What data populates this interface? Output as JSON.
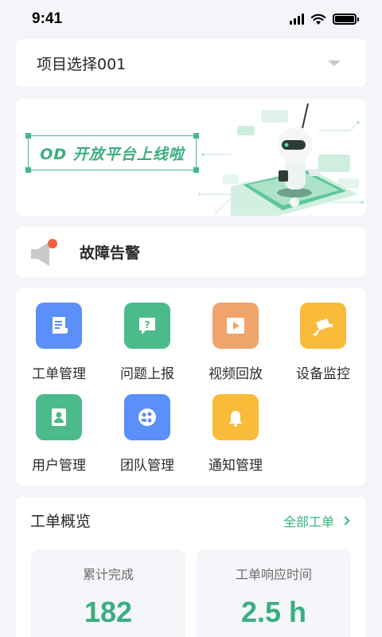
{
  "status_bar": {
    "time": "9:41"
  },
  "project_select": {
    "value": "项目选择001"
  },
  "banner": {
    "text": "OD 开放平台上线啦"
  },
  "alert": {
    "text": "故障告警"
  },
  "menu": {
    "items": [
      {
        "label": "工单管理",
        "color": "#5b8ff9",
        "icon": "document-icon"
      },
      {
        "label": "问题上报",
        "color": "#4cbb8c",
        "icon": "question-icon"
      },
      {
        "label": "视频回放",
        "color": "#f0a36a",
        "icon": "play-icon"
      },
      {
        "label": "设备监控",
        "color": "#f9bb3a",
        "icon": "camera-icon"
      },
      {
        "label": "用户管理",
        "color": "#4cbb8c",
        "icon": "user-card-icon"
      },
      {
        "label": "团队管理",
        "color": "#5b8ff9",
        "icon": "team-icon"
      },
      {
        "label": "通知管理",
        "color": "#f9bb3a",
        "icon": "bell-icon"
      }
    ]
  },
  "overview": {
    "title": "工单概览",
    "link": "全部工单",
    "stats": [
      {
        "label": "累计完成",
        "value": "182"
      },
      {
        "label": "工单响应时间",
        "value": "2.5 h"
      }
    ]
  },
  "colors": {
    "accent": "#3aae7f",
    "alert_dot": "#f2613f"
  }
}
